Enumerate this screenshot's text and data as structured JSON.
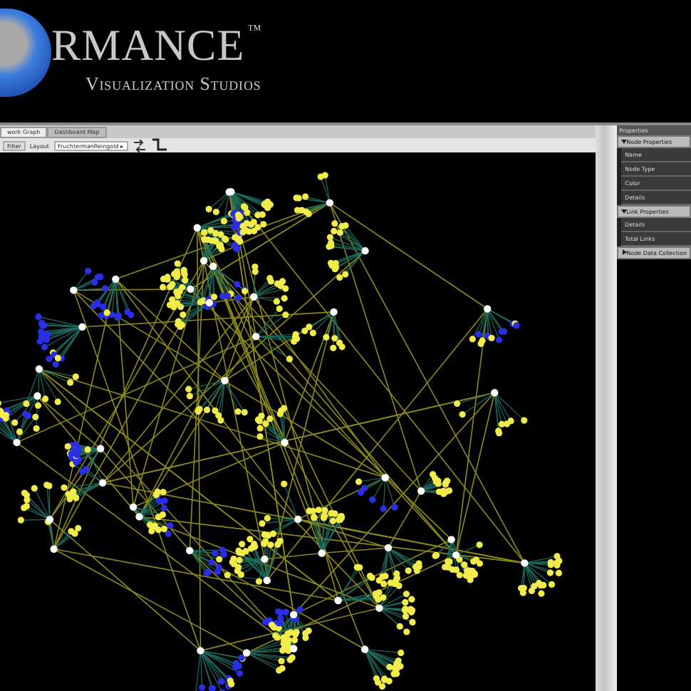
{
  "logo": {
    "wordmark": "RMANCE",
    "trademark": "™",
    "tagline": "Visualization Studios"
  },
  "tabs": [
    {
      "label": "work Graph",
      "selected": true
    },
    {
      "label": "Dashboard Map",
      "selected": false
    }
  ],
  "toolbar": {
    "filter_label": "Filter",
    "layout_label": "Layout",
    "layout_value": "FruchtermanReingold",
    "dropdown_arrow": "▸"
  },
  "properties": {
    "title": "Properties",
    "sections": [
      {
        "title": "Node Properties",
        "expanded": true,
        "fields": [
          "Name",
          "Node Type",
          "Color",
          "Details"
        ]
      },
      {
        "title": "Link Properties",
        "expanded": true,
        "fields": [
          "Details",
          "Total Links"
        ]
      },
      {
        "title": "Node Data Collection",
        "expanded": false
      }
    ]
  }
}
